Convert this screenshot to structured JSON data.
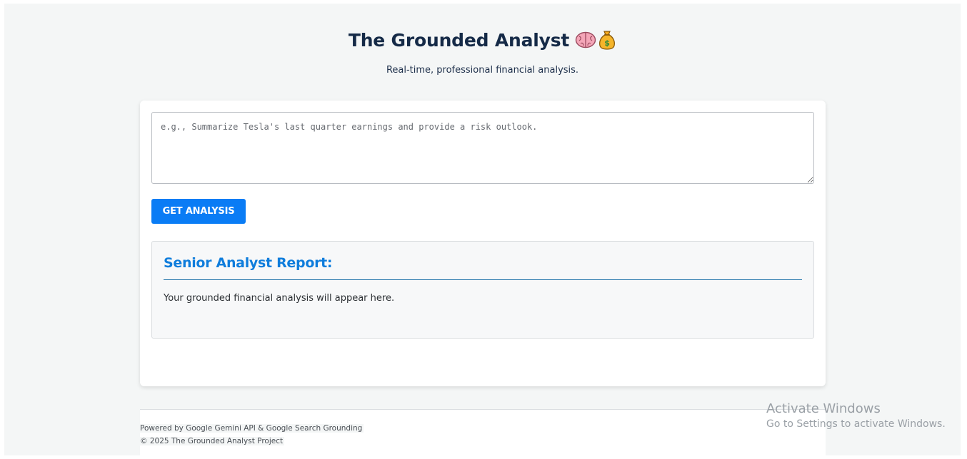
{
  "header": {
    "title": "The Grounded Analyst",
    "title_icons": [
      "brain-icon",
      "money-bag-icon"
    ],
    "subtitle": "Real-time, professional financial analysis."
  },
  "query": {
    "value": "",
    "placeholder": "e.g., Summarize Tesla's last quarter earnings and provide a risk outlook."
  },
  "actions": {
    "analyze_label": "GET ANALYSIS"
  },
  "report": {
    "title": "Senior Analyst Report:",
    "body": "Your grounded financial analysis will appear here."
  },
  "footer": {
    "powered_by": "Powered by Google Gemini API & Google Search Grounding",
    "copyright": "© 2025 The Grounded Analyst Project"
  },
  "os_watermark": {
    "line1": "Activate Windows",
    "line2": "Go to Settings to activate Windows."
  },
  "colors": {
    "page_bg": "#f4f6f6",
    "title": "#152a47",
    "accent_blue": "#0a7cf5",
    "report_title": "#0f7ddc"
  }
}
